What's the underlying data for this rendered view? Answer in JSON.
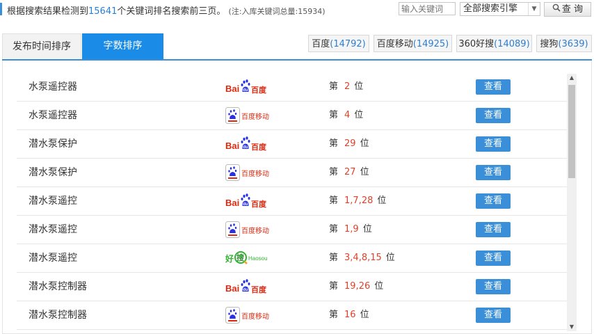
{
  "header": {
    "summary_prefix": "根据搜索结果检测到",
    "keyword_count": "15641",
    "summary_suffix": "个关键词排名搜索前三页。",
    "note": "(注:入库关键词总量:15934)",
    "search_placeholder": "输入关键词",
    "engine_select_value": "全部搜索引擎",
    "query_button": "查 询"
  },
  "tabs": {
    "time_sort": "发布时间排序",
    "count_sort": "字数排序",
    "active": "字数排序"
  },
  "engines": [
    {
      "name": "百度",
      "count": "(14792)"
    },
    {
      "name": "百度移动",
      "count": "(14925)"
    },
    {
      "name": "360好搜",
      "count": "(14089)"
    },
    {
      "name": "搜狗",
      "count": "(3639)"
    }
  ],
  "list": {
    "rank_prefix": "第",
    "rank_suffix": "位",
    "view_label": "查看",
    "rows": [
      {
        "keyword": "水泵遥控器",
        "engine": "baidu",
        "rank": "2"
      },
      {
        "keyword": "水泵遥控器",
        "engine": "baidu-mobile",
        "rank": "4"
      },
      {
        "keyword": "潜水泵保护",
        "engine": "baidu",
        "rank": "29"
      },
      {
        "keyword": "潜水泵保护",
        "engine": "baidu-mobile",
        "rank": "27"
      },
      {
        "keyword": "潜水泵遥控",
        "engine": "baidu",
        "rank": "1,7,28"
      },
      {
        "keyword": "潜水泵遥控",
        "engine": "baidu-mobile",
        "rank": "1,9"
      },
      {
        "keyword": "潜水泵遥控",
        "engine": "haosou",
        "rank": "3,4,8,15"
      },
      {
        "keyword": "潜水泵控制器",
        "engine": "baidu",
        "rank": "19,26"
      },
      {
        "keyword": "潜水泵控制器",
        "engine": "baidu-mobile",
        "rank": "16"
      }
    ]
  },
  "logos": {
    "baidu": {
      "text_left": "Bai",
      "text_du": "du",
      "text_cn": "百度"
    },
    "baidu-mobile": {
      "text": "百度移动"
    },
    "haosou": {
      "text_cn": "好",
      "text_mid": "搜",
      "text_en": "Haosou"
    }
  },
  "colors": {
    "accent": "#1a8be6",
    "button": "#3a8fd8",
    "link_count": "#2a7fd4",
    "rank": "#e0412a",
    "baidu_red": "#de2910",
    "baidu_blue": "#2932e1",
    "haosou_green": "#35b135"
  }
}
